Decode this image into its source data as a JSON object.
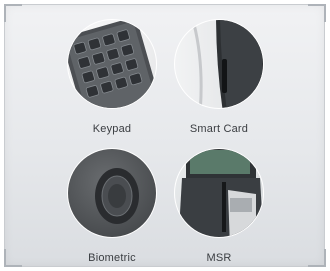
{
  "options": [
    {
      "label": "Keypad",
      "icon": "keypad-icon"
    },
    {
      "label": "Smart Card",
      "icon": "smart-card-reader-icon"
    },
    {
      "label": "Biometric",
      "icon": "fingerprint-sensor-icon"
    },
    {
      "label": "MSR",
      "icon": "magnetic-stripe-reader-icon"
    }
  ]
}
